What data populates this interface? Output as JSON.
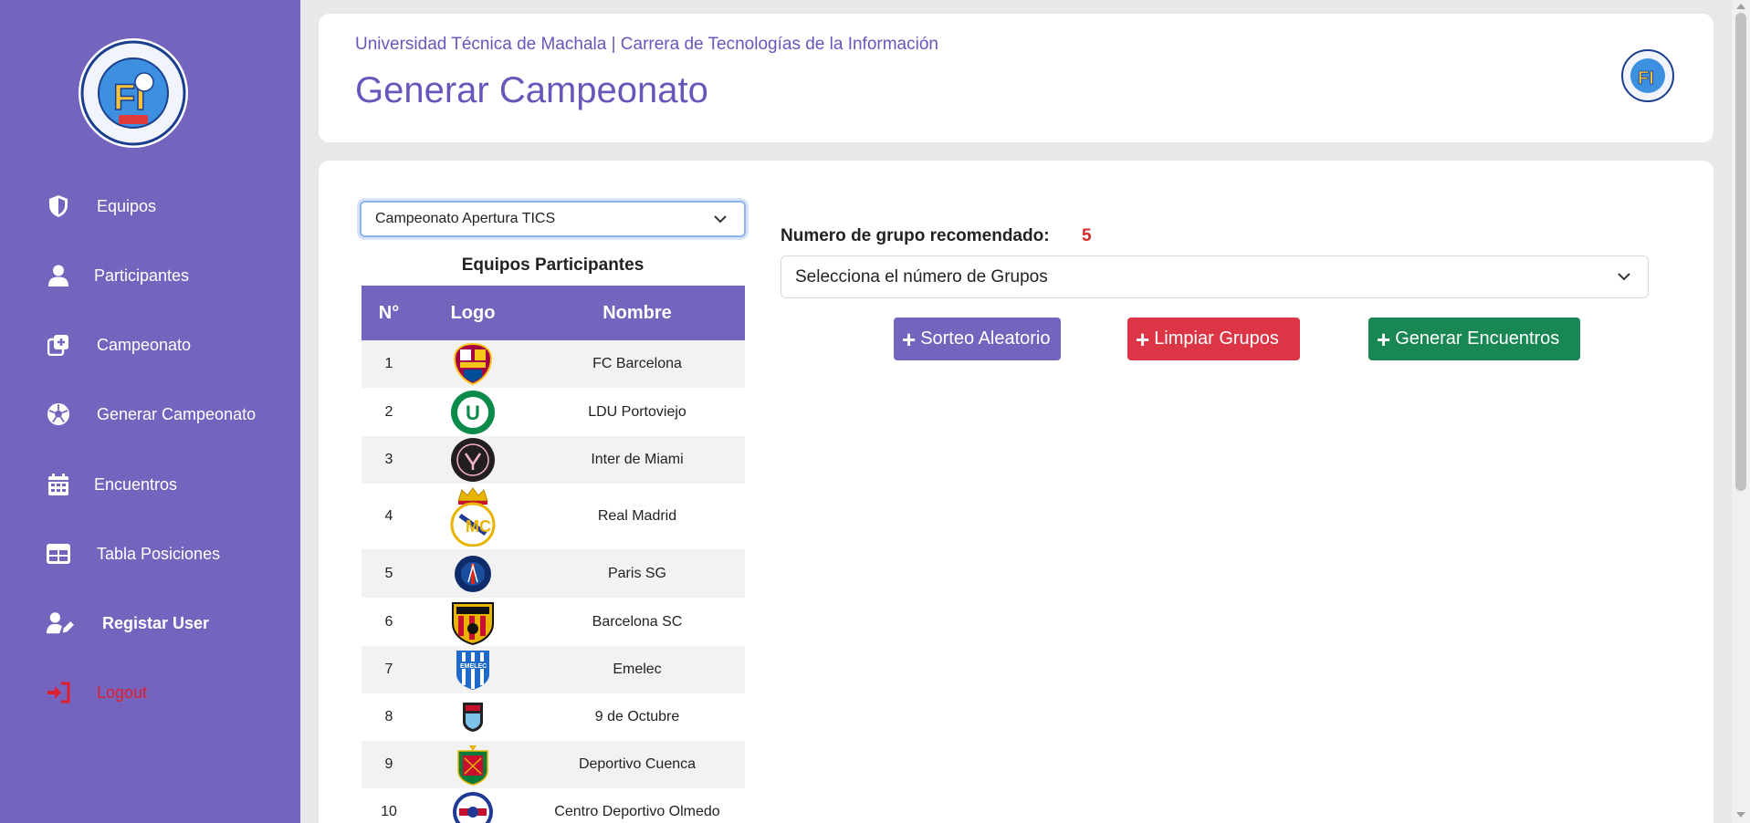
{
  "sidebar": {
    "logo_name": "escuela-informatica-logo",
    "items": [
      {
        "label": "Equipos",
        "icon": "shield-icon"
      },
      {
        "label": "Participantes",
        "icon": "user-icon"
      },
      {
        "label": "Campeonato",
        "icon": "add-copy-icon"
      },
      {
        "label": "Generar Campeonato",
        "icon": "soccer-ball-icon"
      },
      {
        "label": "Encuentros",
        "icon": "calendar-icon"
      },
      {
        "label": "Tabla Posiciones",
        "icon": "table-icon"
      },
      {
        "label": "Registar User",
        "icon": "user-edit-icon"
      },
      {
        "label": "Logout",
        "icon": "logout-icon"
      }
    ]
  },
  "header": {
    "subtitle": "Universidad Técnica de Machala | Carrera de Tecnologías de la Información",
    "title": "Generar Campeonato"
  },
  "main": {
    "championship_select": "Campeonato Apertura TICS",
    "table_title": "Equipos Participantes",
    "columns": [
      "N°",
      "Logo",
      "Nombre"
    ],
    "teams": [
      {
        "n": "1",
        "name": "FC Barcelona"
      },
      {
        "n": "2",
        "name": "LDU Portoviejo"
      },
      {
        "n": "3",
        "name": "Inter de Miami"
      },
      {
        "n": "4",
        "name": "Real Madrid"
      },
      {
        "n": "5",
        "name": "Paris SG"
      },
      {
        "n": "6",
        "name": "Barcelona SC"
      },
      {
        "n": "7",
        "name": "Emelec"
      },
      {
        "n": "8",
        "name": "9 de Octubre"
      },
      {
        "n": "9",
        "name": "Deportivo Cuenca"
      },
      {
        "n": "10",
        "name": "Centro Deportivo Olmedo"
      }
    ],
    "recommend_label": "Numero de grupo recomendado:",
    "recommend_value": "5",
    "groups_select_placeholder": "Selecciona el número de Grupos",
    "buttons": {
      "sorteo": "Sorteo Aleatorio",
      "limpiar": "Limpiar Grupos",
      "generar": "Generar Encuentros"
    }
  },
  "colors": {
    "brand_purple": "#7564be",
    "danger_red": "#dc3545",
    "success_green": "#198754",
    "recommend_red": "#d42a2a"
  }
}
